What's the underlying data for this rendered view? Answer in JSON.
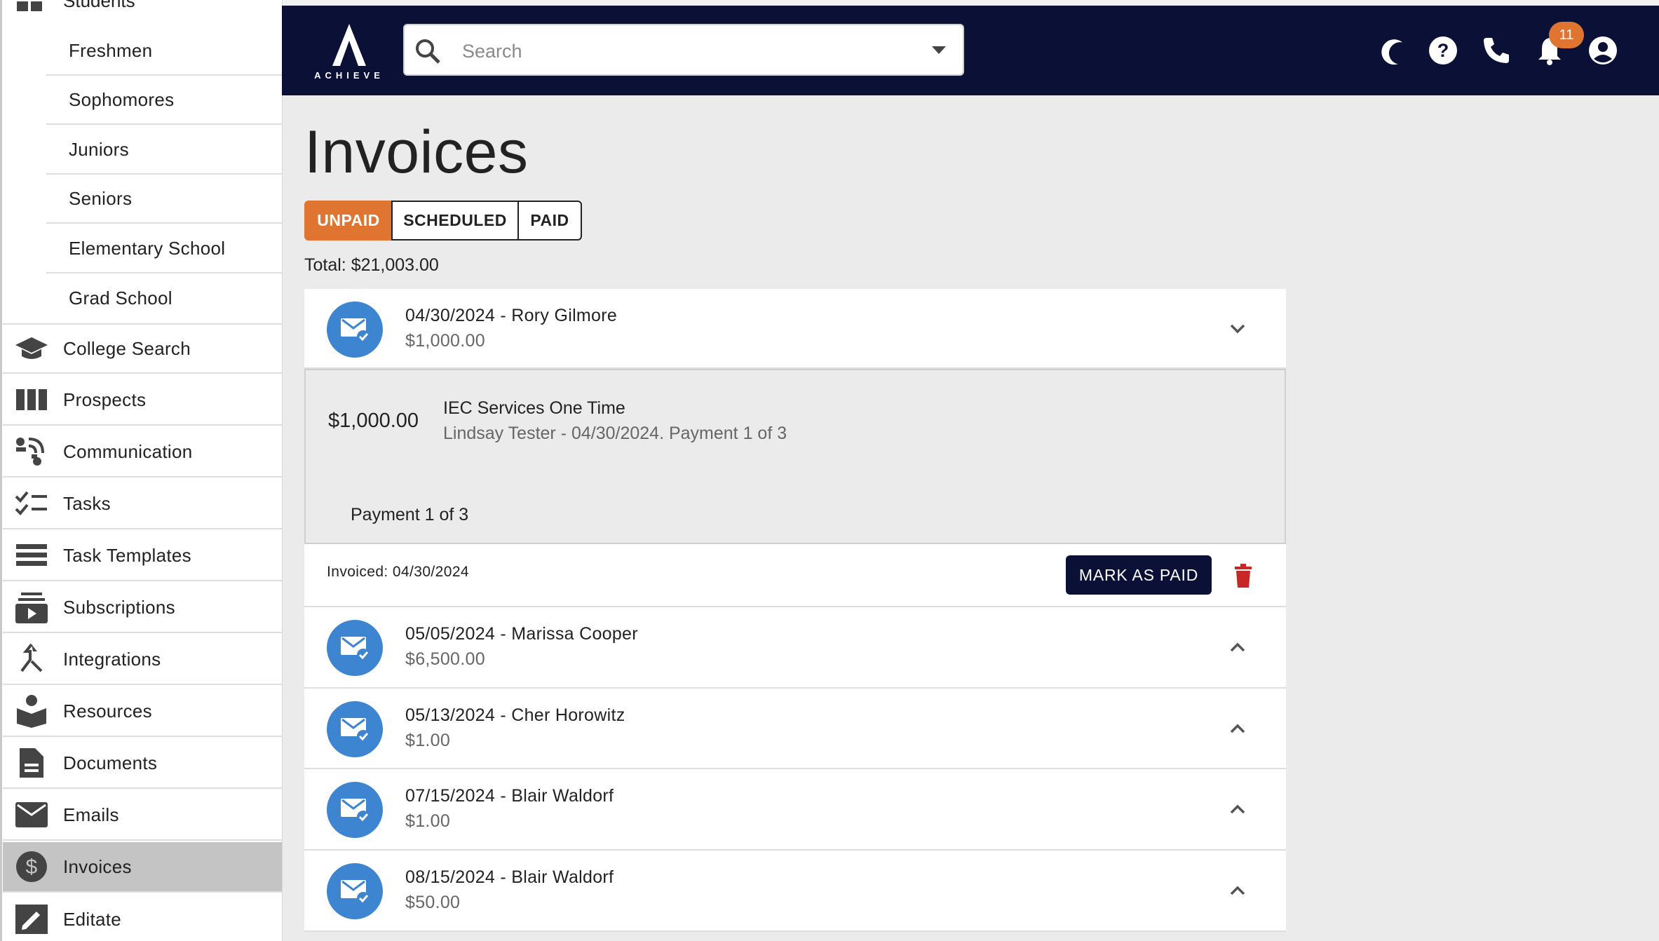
{
  "sidebar": {
    "section_label": "Students",
    "sub_items": [
      "Freshmen",
      "Sophomores",
      "Juniors",
      "Seniors",
      "Elementary School",
      "Grad School"
    ],
    "items": [
      {
        "label": "College Search",
        "icon": "graduation-cap-icon"
      },
      {
        "label": "Prospects",
        "icon": "columns-icon"
      },
      {
        "label": "Communication",
        "icon": "communication-icon"
      },
      {
        "label": "Tasks",
        "icon": "checklist-icon"
      },
      {
        "label": "Task Templates",
        "icon": "list-icon"
      },
      {
        "label": "Subscriptions",
        "icon": "subscriptions-icon"
      },
      {
        "label": "Integrations",
        "icon": "merge-icon"
      },
      {
        "label": "Resources",
        "icon": "book-reader-icon"
      },
      {
        "label": "Documents",
        "icon": "document-icon"
      },
      {
        "label": "Emails",
        "icon": "mail-icon"
      },
      {
        "label": "Invoices",
        "icon": "dollar-icon",
        "active": true
      },
      {
        "label": "Editate",
        "icon": "edit-icon"
      }
    ]
  },
  "header": {
    "logo_text": "ACHIEVE",
    "search_placeholder": "Search",
    "notification_count": "11"
  },
  "main": {
    "title": "Invoices",
    "tabs": [
      {
        "label": "UNPAID",
        "active": true
      },
      {
        "label": "SCHEDULED",
        "active": false
      },
      {
        "label": "PAID",
        "active": false
      }
    ],
    "total": "Total: $21,003.00",
    "invoices": [
      {
        "title": "04/30/2024 - Rory Gilmore",
        "amount": "$1,000.00",
        "expanded": true
      },
      {
        "title": "05/05/2024 - Marissa Cooper",
        "amount": "$6,500.00"
      },
      {
        "title": "05/13/2024 - Cher Horowitz",
        "amount": "$1.00"
      },
      {
        "title": "07/15/2024 - Blair Waldorf",
        "amount": "$1.00"
      },
      {
        "title": "08/15/2024 - Blair Waldorf",
        "amount": "$50.00"
      }
    ],
    "detail": {
      "amount": "$1,000.00",
      "service": "IEC Services One Time",
      "subtitle": "Lindsay Tester - 04/30/2024. Payment 1 of 3",
      "payment": "Payment 1 of 3",
      "invoiced": "Invoiced: 04/30/2024",
      "mark_paid_label": "MARK AS PAID"
    }
  },
  "colors": {
    "header_bg": "#0b1136",
    "accent": "#e07431",
    "avatar": "#3d85d0",
    "delete": "#c62828"
  }
}
